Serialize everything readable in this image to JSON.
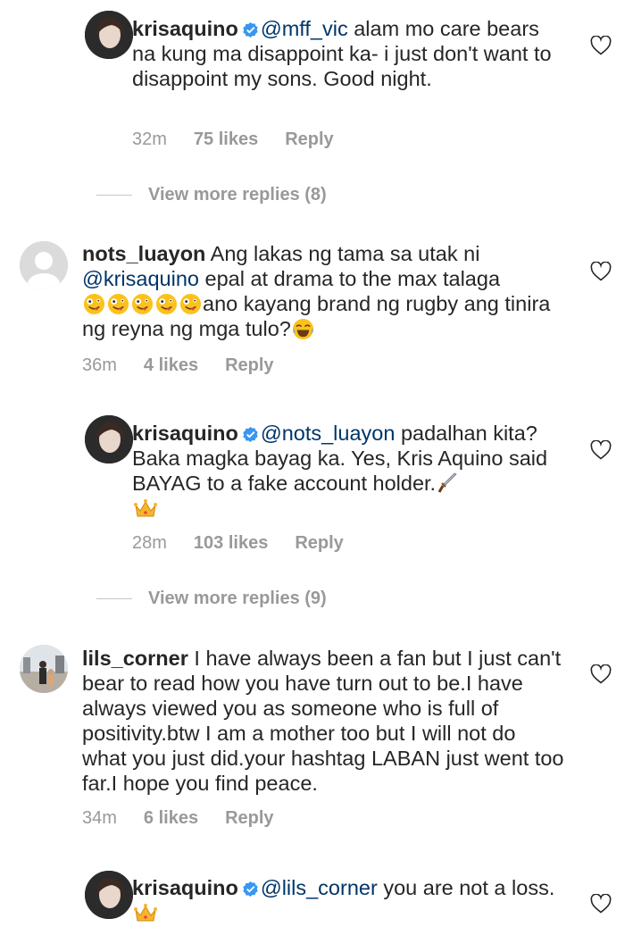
{
  "comments": [
    {
      "username": "krisaquino",
      "verified": true,
      "mention": "@mff_vic",
      "text": " alam mo care bears na kung ma disappoint ka- i just don't want to disappoint my sons. Good night.",
      "time": "32m",
      "likes": "75 likes",
      "reply": "Reply",
      "avatar_icon": "profile-photo-krisaquino"
    },
    {
      "view_more": "View more replies (8)"
    },
    {
      "username": "nots_luayon",
      "verified": false,
      "text_a": " Ang lakas ng tama sa utak ni ",
      "mention": "@krisaquino",
      "text_b": " epal at drama to the max talaga",
      "text_c": "ano kayang brand ng rugby ang tinira ng reyna ng mga tulo?",
      "emoji_a": "crazy-face-emoji x5",
      "emoji_b": "tears-of-joy-emoji",
      "time": "36m",
      "likes": "4 likes",
      "reply": "Reply",
      "avatar_icon": "default-avatar-icon"
    },
    {
      "username": "krisaquino",
      "verified": true,
      "mention": "@nots_luayon",
      "text": " padalhan kita? Baka magka bayag ka. Yes, Kris Aquino said BAYAG to a fake account holder.",
      "emoji": [
        "dagger-emoji",
        "crown-emoji"
      ],
      "time": "28m",
      "likes": "103 likes",
      "reply": "Reply",
      "avatar_icon": "profile-photo-krisaquino"
    },
    {
      "view_more": "View more replies (9)"
    },
    {
      "username": "lils_corner",
      "verified": false,
      "text": " I have always been a fan but I just can't bear to read how you have turn out to be.I have always viewed you as someone who is full of positivity.btw I am a mother too but I will not do what you just did.your hashtag LABAN just went too far.I hope you find peace.",
      "time": "34m",
      "likes": "6 likes",
      "reply": "Reply",
      "avatar_icon": "profile-photo-lils-corner"
    },
    {
      "username": "krisaquino",
      "verified": true,
      "mention": "@lils_corner",
      "text": " you are not a loss.",
      "emoji": [
        "crown-emoji"
      ],
      "avatar_icon": "profile-photo-krisaquino"
    }
  ],
  "colors": {
    "text": "#262626",
    "mention": "#003569",
    "meta": "#999999",
    "verified": "#3897f0"
  }
}
